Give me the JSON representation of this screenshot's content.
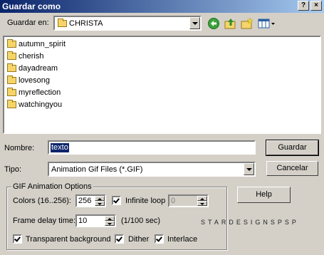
{
  "window": {
    "title": "Guardar como"
  },
  "titlebar_buttons": {
    "help": "?",
    "close": "×"
  },
  "save_in": {
    "label": "Guardar en:",
    "value": "CHRISTA"
  },
  "toolbar_icons": [
    "back-arrow-icon",
    "up-folder-icon",
    "new-folder-icon",
    "view-menu-icon"
  ],
  "folders": [
    {
      "name": "autumn_spirit"
    },
    {
      "name": "cherish"
    },
    {
      "name": "dayadream"
    },
    {
      "name": "lovesong"
    },
    {
      "name": "myreflection"
    },
    {
      "name": "watchingyou"
    }
  ],
  "filename": {
    "label": "Nombre:",
    "value": "texto"
  },
  "filetype": {
    "label": "Tipo:",
    "value": "Animation Gif Files (*.GIF)"
  },
  "buttons": {
    "save": "Guardar",
    "cancel": "Cancelar",
    "help": "Help"
  },
  "gif_options": {
    "title": "GIF Animation Options",
    "colors_label": "Colors (16..256):",
    "colors_value": "256",
    "infinite_loop_label": "Infinite loop",
    "infinite_loop_checked": true,
    "loop_value": "0",
    "frame_delay_label": "Frame delay time:",
    "frame_delay_value": "10",
    "frame_delay_unit": "(1/100 sec)",
    "transparent_label": "Transparent background",
    "transparent_checked": true,
    "dither_label": "Dither",
    "dither_checked": true,
    "interlace_label": "Interlace",
    "interlace_checked": true
  },
  "watermark": "STARDESIGNSPSP",
  "colors": {
    "titlebar_start": "#0a246a",
    "titlebar_end": "#a6caf0",
    "selection": "#0a246a",
    "face": "#d4d0c8"
  }
}
